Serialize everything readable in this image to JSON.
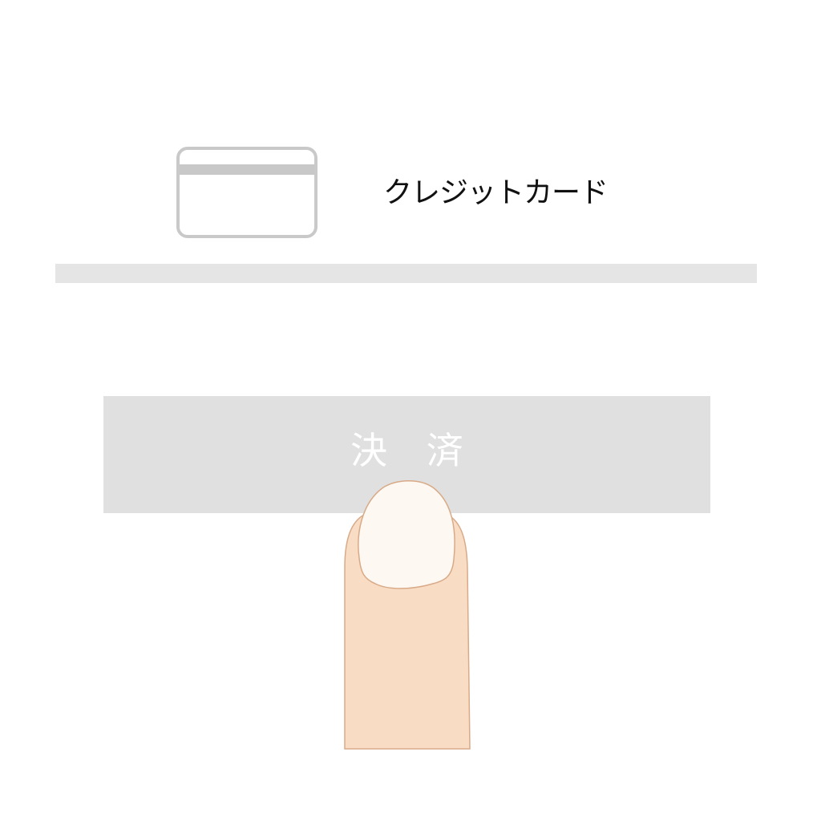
{
  "payment_method": {
    "icon": "credit-card-icon",
    "label": "クレジットカード"
  },
  "pay_button": {
    "label": "決 済",
    "background_color": "#dfe0df",
    "text_color": "#ffffff"
  },
  "illustration": {
    "icon": "finger-tap-icon",
    "skin_color": "#f9dcc4",
    "nail_color": "#fdf8f1"
  }
}
